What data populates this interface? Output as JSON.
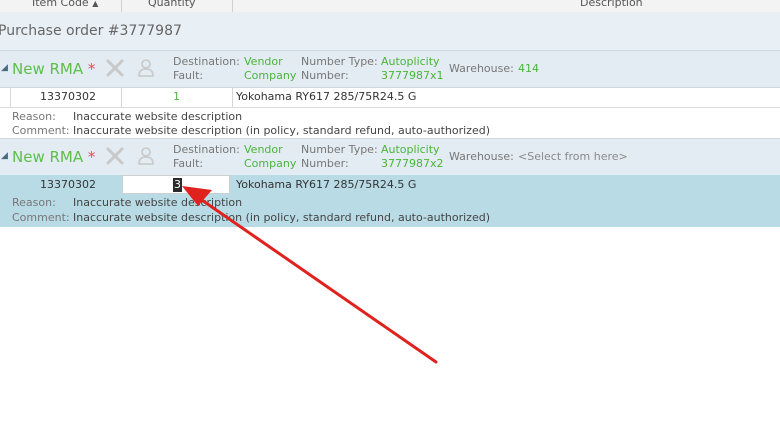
{
  "header": {
    "item_code": "Item Code",
    "sort_indicator": "▲",
    "quantity": "Quantity",
    "description": "Description"
  },
  "purchase_order": {
    "title": "Purchase order #3777987"
  },
  "rmas": [
    {
      "title": "New RMA",
      "required_mark": "*",
      "destination_label": "Destination:",
      "fault_label": "Fault:",
      "destination_value_line1": "Vendor",
      "destination_value_line2": "Company",
      "number_type_label": "Number Type:",
      "number_label": "Number:",
      "number_type_value": "Autoplicity",
      "number_value": "3777987x1",
      "warehouse_label": "Warehouse:",
      "warehouse_value": "414",
      "line": {
        "item_code": "13370302",
        "quantity": "1",
        "description": "Yokohama RY617 285/75R24.5 G"
      },
      "reason_label": "Reason:",
      "reason_value": "Inaccurate website description",
      "comment_label": "Comment:",
      "comment_value": "Inaccurate website description (in policy, standard refund, auto-authorized)"
    },
    {
      "title": "New RMA",
      "required_mark": "*",
      "destination_label": "Destination:",
      "fault_label": "Fault:",
      "destination_value_line1": "Vendor",
      "destination_value_line2": "Company",
      "number_type_label": "Number Type:",
      "number_label": "Number:",
      "number_type_value": "Autoplicity",
      "number_value": "3777987x2",
      "warehouse_label": "Warehouse:",
      "warehouse_placeholder": "<Select from here>",
      "line": {
        "item_code": "13370302",
        "quantity": "3",
        "description": "Yokohama RY617 285/75R24.5 G"
      },
      "reason_label": "Reason:",
      "reason_value": "Inaccurate website description",
      "comment_label": "Comment:",
      "comment_value": "Inaccurate website description (in policy, standard refund, auto-authorized)"
    }
  ],
  "colors": {
    "accent_green": "#4ab53a",
    "selected_row": "#b9dbe6",
    "arrow_red": "#e0221e"
  }
}
